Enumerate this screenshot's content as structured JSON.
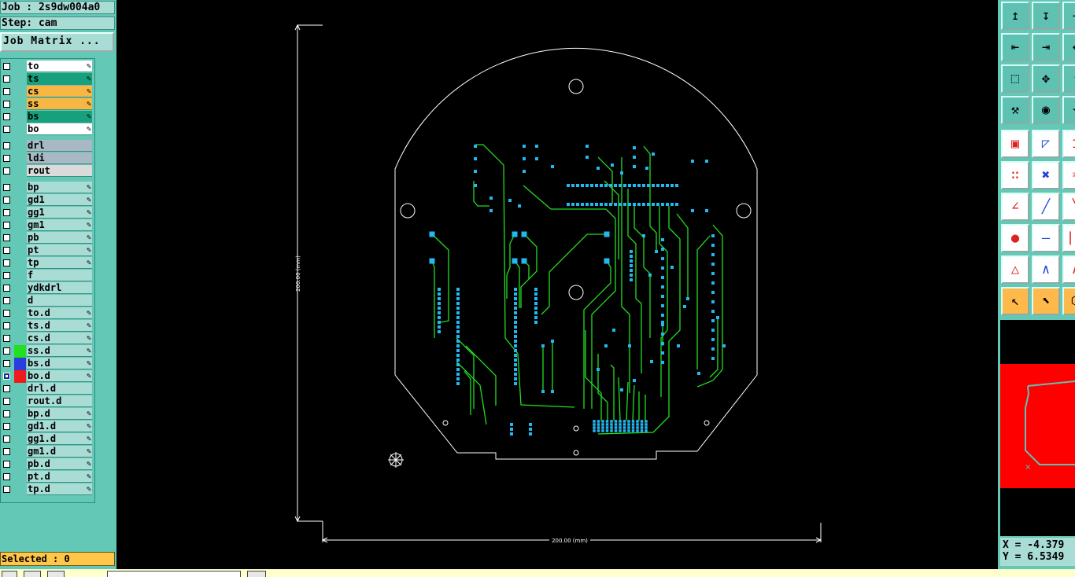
{
  "header": {
    "job_label": "Job : 2s9dw004a0",
    "step_label": "Step: cam",
    "job_matrix_button": "Job Matrix ..."
  },
  "layers": [
    {
      "name": "to",
      "color": "white",
      "swatch": "",
      "edit": true
    },
    {
      "name": "ts",
      "color": "teal",
      "swatch": "",
      "edit": true
    },
    {
      "name": "cs",
      "color": "orange",
      "swatch": "",
      "edit": true
    },
    {
      "name": "ss",
      "color": "orange",
      "swatch": "",
      "edit": true
    },
    {
      "name": "bs",
      "color": "teal",
      "swatch": "",
      "edit": true
    },
    {
      "name": "bo",
      "color": "white",
      "swatch": "",
      "edit": true
    },
    {
      "name": "drl",
      "color": "grey",
      "swatch": "",
      "edit": false
    },
    {
      "name": "ldi",
      "color": "grey",
      "swatch": "",
      "edit": false
    },
    {
      "name": "rout",
      "color": "lgrey",
      "swatch": "",
      "edit": false
    },
    {
      "name": "bp",
      "color": "default",
      "swatch": "",
      "edit": true
    },
    {
      "name": "gd1",
      "color": "default",
      "swatch": "",
      "edit": true
    },
    {
      "name": "gg1",
      "color": "default",
      "swatch": "",
      "edit": true
    },
    {
      "name": "gm1",
      "color": "default",
      "swatch": "",
      "edit": true
    },
    {
      "name": "pb",
      "color": "default",
      "swatch": "",
      "edit": true
    },
    {
      "name": "pt",
      "color": "default",
      "swatch": "",
      "edit": true
    },
    {
      "name": "tp",
      "color": "default",
      "swatch": "",
      "edit": true
    },
    {
      "name": "f",
      "color": "default",
      "swatch": "",
      "edit": false
    },
    {
      "name": "ydkdrl",
      "color": "default",
      "swatch": "",
      "edit": false
    },
    {
      "name": "d",
      "color": "default",
      "swatch": "",
      "edit": false
    },
    {
      "name": "to.d",
      "color": "default",
      "swatch": "",
      "edit": true
    },
    {
      "name": "ts.d",
      "color": "default",
      "swatch": "",
      "edit": true
    },
    {
      "name": "cs.d",
      "color": "default",
      "swatch": "",
      "edit": true
    },
    {
      "name": "ss.d",
      "color": "default",
      "swatch": "#22e01f",
      "edit": true
    },
    {
      "name": "bs.d",
      "color": "default",
      "swatch": "#2a3ee0",
      "edit": true
    },
    {
      "name": "bo.d",
      "color": "default",
      "swatch": "#f01a1a",
      "edit": true,
      "selected": true
    },
    {
      "name": "drl.d",
      "color": "default",
      "swatch": "",
      "edit": false
    },
    {
      "name": "rout.d",
      "color": "default",
      "swatch": "",
      "edit": false
    },
    {
      "name": "bp.d",
      "color": "default",
      "swatch": "",
      "edit": true
    },
    {
      "name": "gd1.d",
      "color": "default",
      "swatch": "",
      "edit": true
    },
    {
      "name": "gg1.d",
      "color": "default",
      "swatch": "",
      "edit": true
    },
    {
      "name": "gm1.d",
      "color": "default",
      "swatch": "",
      "edit": true
    },
    {
      "name": "pb.d",
      "color": "default",
      "swatch": "",
      "edit": true
    },
    {
      "name": "pt.d",
      "color": "default",
      "swatch": "",
      "edit": true
    },
    {
      "name": "tp.d",
      "color": "default",
      "swatch": "",
      "edit": true
    }
  ],
  "status": {
    "selected_label": "Selected : 0"
  },
  "canvas": {
    "dim_vertical": "200.00 (mm)",
    "dim_horizontal": "200.00 (mm)",
    "colors": {
      "background": "#000000",
      "outline": "#ffffff",
      "traces": "#22dd22",
      "pads": "#22b8f0"
    }
  },
  "toolbar": {
    "tools": [
      {
        "icon": "move-up-icon"
      },
      {
        "icon": "move-down-icon"
      },
      {
        "icon": "arrow-right-icon"
      },
      {
        "icon": "snap-left-icon"
      },
      {
        "icon": "snap-right-icon"
      },
      {
        "icon": "arrow-left-icon"
      },
      {
        "icon": "fit-view-icon"
      },
      {
        "icon": "pan-icon"
      },
      {
        "icon": "arrow-up-icon"
      },
      {
        "icon": "tools-palette-icon"
      },
      {
        "icon": "probe-icon"
      },
      {
        "icon": "net-icon"
      },
      {
        "icon": "select-pad-icon"
      },
      {
        "icon": "select-area-icon"
      },
      {
        "icon": "measure-icon"
      },
      {
        "icon": "connect-icon"
      },
      {
        "icon": "cross-icon"
      },
      {
        "icon": "cut-icon"
      },
      {
        "icon": "angle-icon"
      },
      {
        "icon": "line-icon"
      },
      {
        "icon": "line-alt-icon"
      },
      {
        "icon": "add-pad-icon"
      },
      {
        "icon": "h-line-icon"
      },
      {
        "icon": "v-line-icon"
      },
      {
        "icon": "triangle-icon"
      },
      {
        "icon": "peak-icon"
      },
      {
        "icon": "peak-alt-icon"
      },
      {
        "icon": "pointer-icon"
      },
      {
        "icon": "pointer-box-icon"
      },
      {
        "icon": "shape-icon"
      }
    ]
  },
  "coordinates": {
    "x": "X = -4.379",
    "y": "Y = 6.5349"
  }
}
